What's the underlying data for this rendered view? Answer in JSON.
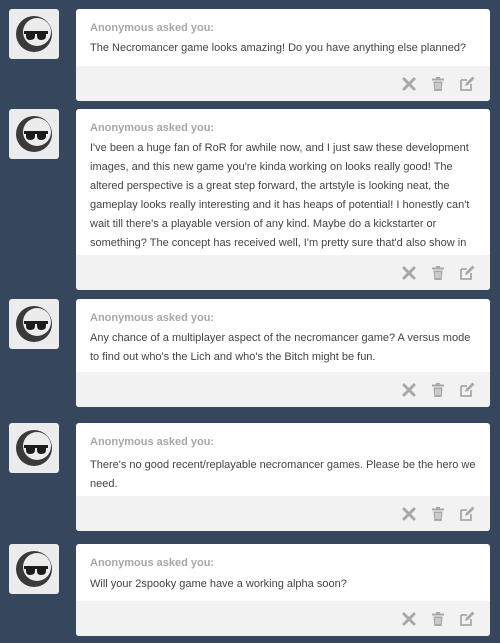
{
  "posts": [
    {
      "asker": "Anonymous asked you:",
      "question": "The Necromancer game looks amazing! Do you have anything else planned?"
    },
    {
      "asker": "Anonymous asked you:",
      "question": "I've been a huge fan of RoR for awhile now, and I just saw these development images, and this new game you're kinda working on looks really good! The altered perspective is a great step forward, the artstyle is looking neat, the gameplay looks really interesting and it has heaps of potential! I honestly can't wait till there's a playable version of any kind. Maybe do a kickstarter or something? The concept has received well, I'm pretty sure that'd also show in backers, too. I know I would!"
    },
    {
      "asker": "Anonymous asked you:",
      "question": "Any chance of a multiplayer aspect of the necromancer game? A versus mode to find out who's the Lich and who's the Bitch might be fun."
    },
    {
      "asker": "Anonymous asked you:",
      "question": "There's no good recent/replayable necromancer games. Please be the hero we need."
    },
    {
      "asker": "Anonymous asked you:",
      "question": "Will your 2spooky game have a working alpha soon?"
    }
  ],
  "icons": {
    "avatar": "anonymous-sunglasses-avatar",
    "delete": "x-icon",
    "trash": "trash-icon",
    "edit": "edit-icon"
  },
  "colors": {
    "background": "#36465d",
    "card": "#ffffff",
    "footer": "#f2f2f2",
    "asker": "#a7a7a7",
    "text": "#444444",
    "icon": "#a8a8a8"
  }
}
